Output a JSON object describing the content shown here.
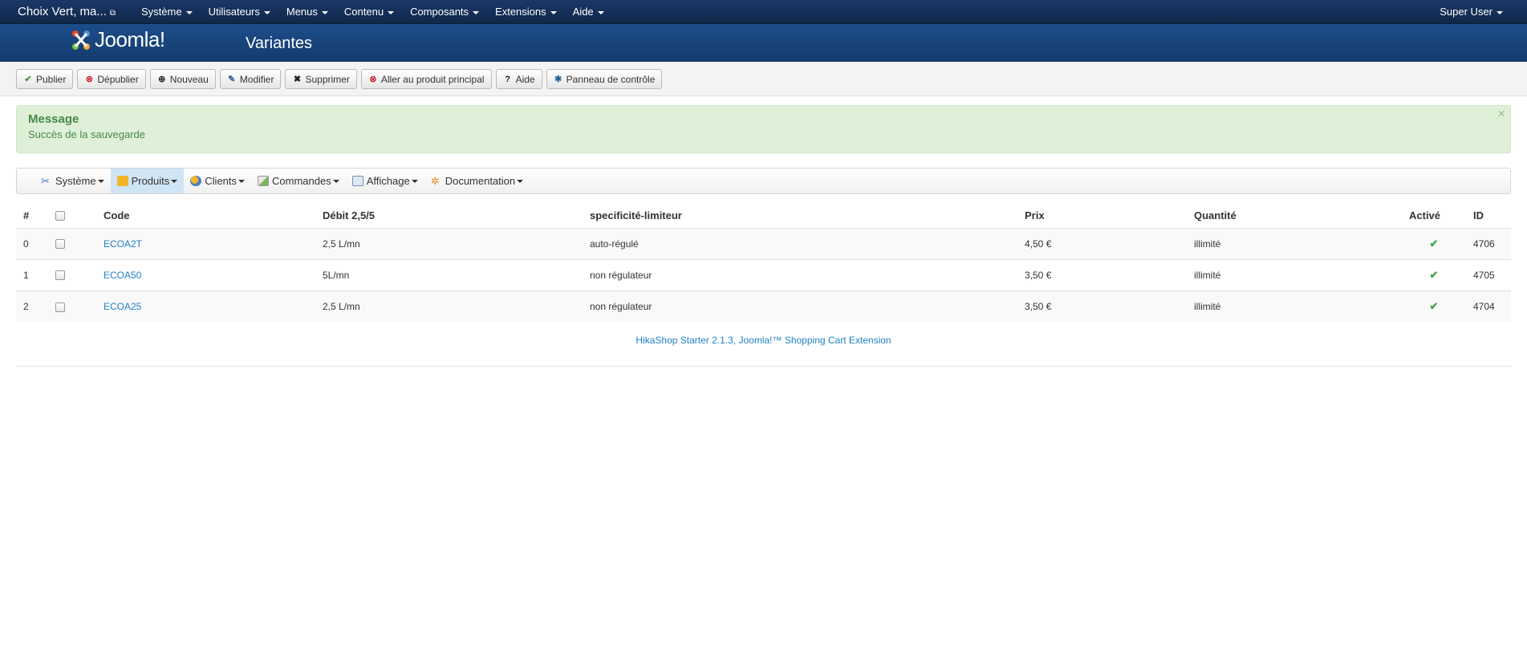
{
  "navbar": {
    "site_name": "Choix Vert, ma...",
    "menu": [
      "Système",
      "Utilisateurs",
      "Menus",
      "Contenu",
      "Composants",
      "Extensions",
      "Aide"
    ],
    "user": "Super User"
  },
  "header": {
    "logo_text": "Joomla!",
    "title": "Variantes"
  },
  "toolbar": {
    "publish": "Publier",
    "unpublish": "Dépublier",
    "new": "Nouveau",
    "edit": "Modifier",
    "delete": "Supprimer",
    "goto_main": "Aller au produit principal",
    "help": "Aide",
    "control_panel": "Panneau de contrôle"
  },
  "alert": {
    "title": "Message",
    "text": "Succès de la sauvegarde",
    "close": "×"
  },
  "submenu": {
    "items": [
      "Système",
      "Produits",
      "Clients",
      "Commandes",
      "Affichage",
      "Documentation"
    ],
    "active": "Produits"
  },
  "table": {
    "headers": {
      "num": "#",
      "code": "Code",
      "debit": "Débit 2,5/5",
      "spec": "specificité-limiteur",
      "price": "Prix",
      "qty": "Quantité",
      "active": "Activé",
      "id": "ID"
    },
    "rows": [
      {
        "num": "0",
        "code": "ECOA2T",
        "debit": "2,5 L/mn",
        "spec": "auto-régulé",
        "price": "4,50 €",
        "qty": "illimité",
        "active": true,
        "id": "4706"
      },
      {
        "num": "1",
        "code": "ECOA50",
        "debit": "5L/mn",
        "spec": "non régulateur",
        "price": "3,50 €",
        "qty": "illimité",
        "active": true,
        "id": "4705"
      },
      {
        "num": "2",
        "code": "ECOA25",
        "debit": "2,5 L/mn",
        "spec": "non régulateur",
        "price": "3,50 €",
        "qty": "illimité",
        "active": true,
        "id": "4704"
      }
    ]
  },
  "footer": {
    "text": "HikaShop Starter 2.1.3, Joomla!™ Shopping Cart Extension"
  }
}
